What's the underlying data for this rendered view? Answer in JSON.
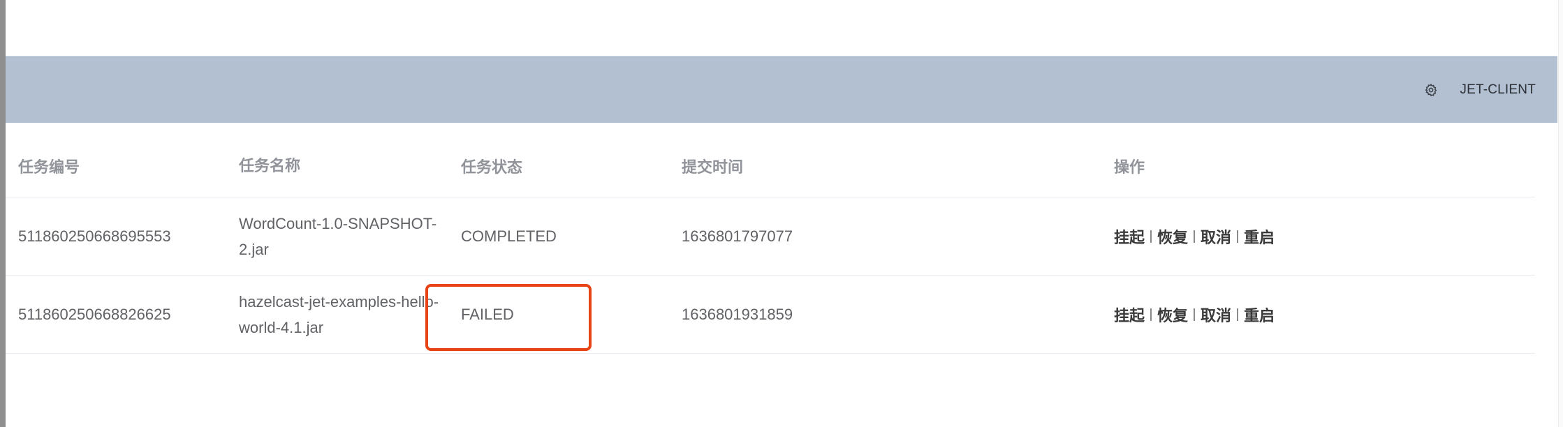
{
  "header": {
    "client_name": "JET-CLIENT",
    "settings_icon": "gear-icon"
  },
  "table": {
    "columns": [
      "任务编号",
      "任务名称",
      "任务状态",
      "提交时间",
      "操作"
    ],
    "rows": [
      {
        "id": "511860250668695553",
        "name": "WordCount-1.0-SNAPSHOT-2.jar",
        "status": "COMPLETED",
        "submit_time": "1636801797077",
        "ops": [
          "挂起",
          "恢复",
          "取消",
          "重启"
        ]
      },
      {
        "id": "511860250668826625",
        "name": "hazelcast-jet-examples-hello-world-4.1.jar",
        "status": "FAILED",
        "submit_time": "1636801931859",
        "ops": [
          "挂起",
          "恢复",
          "取消",
          "重启"
        ]
      }
    ]
  },
  "annotation": {
    "highlight_color": "#e84315"
  }
}
